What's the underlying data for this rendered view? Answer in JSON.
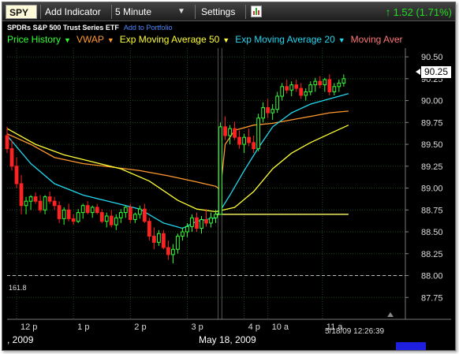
{
  "toolbar": {
    "symbol": "SPY",
    "add_indicator": "Add Indicator",
    "interval": "5 Minute",
    "settings": "Settings",
    "change": "1.52 (1.71%)",
    "change_color": "#22dd22"
  },
  "security": {
    "name": "SPDRs S&P 500 Trust Series ETF",
    "add_to_portfolio": "Add to Portfolio"
  },
  "legend": [
    {
      "label": "Price History",
      "color": "#33ff33"
    },
    {
      "label": "VWAP",
      "color": "#ff9a2e"
    },
    {
      "label": "Exp Moving Average 50",
      "color": "#ffff33"
    },
    {
      "label": "Exp Moving Average 20",
      "color": "#22d8f0"
    },
    {
      "label": "Moving Aver",
      "color": "#ff7777"
    }
  ],
  "price_tag": "90.25",
  "fib_label": "161.8",
  "timestamp": "5/18/09 12:26:39",
  "dates": {
    "left": ", 2009",
    "center": "May 18, 2009"
  },
  "chart_data": {
    "type": "line",
    "title": "",
    "xlabel": "",
    "ylabel": "",
    "grid": true,
    "ylim": [
      87.5,
      90.6
    ],
    "y_ticks": [
      "90.50",
      "90.25",
      "90.00",
      "89.75",
      "89.50",
      "89.25",
      "89.00",
      "88.75",
      "88.50",
      "88.25",
      "88.00",
      "87.75"
    ],
    "x_ticks": [
      "12 p",
      "1 p",
      "2 p",
      "3 p",
      "4 p",
      "10 a",
      "11 a"
    ],
    "x_tick_positions": [
      2.0,
      14.0,
      26.0,
      38.0,
      50.0,
      55.0,
      66.5
    ],
    "x_range": [
      0,
      84
    ],
    "horizontal_line": {
      "label": "161.8",
      "value": 88.0,
      "style": "dashed"
    },
    "candles": [
      [
        89.6,
        89.7,
        89.4,
        89.45
      ],
      [
        89.45,
        89.55,
        89.2,
        89.25
      ],
      [
        89.25,
        89.35,
        89.0,
        89.05
      ],
      [
        89.05,
        89.15,
        88.7,
        88.8
      ],
      [
        88.8,
        88.9,
        88.7,
        88.85
      ],
      [
        88.85,
        88.92,
        88.75,
        88.9
      ],
      [
        88.9,
        88.95,
        88.82,
        88.85
      ],
      [
        88.85,
        88.92,
        88.72,
        88.75
      ],
      [
        88.75,
        88.92,
        88.7,
        88.9
      ],
      [
        88.9,
        88.96,
        88.82,
        88.85
      ],
      [
        88.85,
        88.9,
        88.75,
        88.8
      ],
      [
        88.8,
        88.85,
        88.6,
        88.65
      ],
      [
        88.65,
        88.78,
        88.58,
        88.75
      ],
      [
        88.75,
        88.82,
        88.62,
        88.65
      ],
      [
        88.65,
        88.7,
        88.58,
        88.62
      ],
      [
        88.62,
        88.76,
        88.6,
        88.72
      ],
      [
        88.72,
        88.82,
        88.65,
        88.8
      ],
      [
        88.8,
        88.85,
        88.7,
        88.72
      ],
      [
        88.72,
        88.8,
        88.66,
        88.78
      ],
      [
        88.78,
        88.82,
        88.7,
        88.72
      ],
      [
        88.72,
        88.76,
        88.6,
        88.62
      ],
      [
        88.62,
        88.72,
        88.55,
        88.68
      ],
      [
        88.68,
        88.75,
        88.55,
        88.58
      ],
      [
        88.58,
        88.7,
        88.52,
        88.66
      ],
      [
        88.66,
        88.76,
        88.6,
        88.72
      ],
      [
        88.72,
        88.8,
        88.66,
        88.78
      ],
      [
        88.78,
        88.82,
        88.6,
        88.64
      ],
      [
        88.64,
        88.72,
        88.6,
        88.7
      ],
      [
        88.7,
        88.8,
        88.65,
        88.76
      ],
      [
        88.76,
        88.82,
        88.6,
        88.62
      ],
      [
        88.62,
        88.66,
        88.4,
        88.45
      ],
      [
        88.45,
        88.55,
        88.3,
        88.38
      ],
      [
        88.38,
        88.52,
        88.34,
        88.48
      ],
      [
        88.48,
        88.52,
        88.3,
        88.32
      ],
      [
        88.32,
        88.4,
        88.18,
        88.24
      ],
      [
        88.24,
        88.36,
        88.14,
        88.3
      ],
      [
        88.3,
        88.48,
        88.25,
        88.45
      ],
      [
        88.45,
        88.55,
        88.4,
        88.5
      ],
      [
        88.5,
        88.6,
        88.44,
        88.56
      ],
      [
        88.56,
        88.7,
        88.5,
        88.66
      ],
      [
        88.66,
        88.72,
        88.5,
        88.54
      ],
      [
        88.54,
        88.68,
        88.48,
        88.64
      ],
      [
        88.64,
        88.76,
        88.56,
        88.6
      ],
      [
        88.6,
        88.72,
        88.55,
        88.66
      ],
      [
        88.66,
        88.75,
        88.6,
        88.7
      ],
      [
        88.7,
        89.75,
        89.6,
        89.7
      ],
      [
        89.7,
        89.82,
        89.55,
        89.6
      ],
      [
        89.6,
        89.72,
        89.5,
        89.68
      ],
      [
        89.68,
        89.76,
        89.55,
        89.58
      ],
      [
        89.58,
        89.66,
        89.45,
        89.5
      ],
      [
        89.5,
        89.62,
        89.4,
        89.58
      ],
      [
        89.58,
        89.68,
        89.48,
        89.52
      ],
      [
        89.52,
        89.6,
        89.4,
        89.45
      ],
      [
        89.45,
        89.85,
        89.42,
        89.8
      ],
      [
        89.8,
        89.98,
        89.75,
        89.92
      ],
      [
        89.92,
        90.02,
        89.8,
        89.86
      ],
      [
        89.86,
        89.96,
        89.78,
        89.9
      ],
      [
        89.9,
        90.1,
        89.86,
        90.05
      ],
      [
        90.05,
        90.2,
        90.0,
        90.16
      ],
      [
        90.16,
        90.24,
        90.08,
        90.12
      ],
      [
        90.12,
        90.22,
        90.05,
        90.18
      ],
      [
        90.18,
        90.24,
        90.1,
        90.14
      ],
      [
        90.14,
        90.2,
        90.02,
        90.06
      ],
      [
        90.06,
        90.14,
        90.0,
        90.1
      ],
      [
        90.1,
        90.22,
        90.06,
        90.18
      ],
      [
        90.18,
        90.26,
        90.1,
        90.22
      ],
      [
        90.22,
        90.28,
        90.14,
        90.18
      ],
      [
        90.18,
        90.26,
        90.1,
        90.24
      ],
      [
        90.24,
        90.3,
        90.06,
        90.1
      ],
      [
        90.1,
        90.2,
        90.06,
        90.16
      ],
      [
        90.16,
        90.24,
        90.1,
        90.2
      ],
      [
        90.2,
        90.3,
        90.16,
        90.25
      ]
    ],
    "series": [
      {
        "name": "VWAP",
        "color": "#ff9a2e",
        "points": [
          [
            0,
            89.62
          ],
          [
            5,
            89.5
          ],
          [
            10,
            89.35
          ],
          [
            16,
            89.28
          ],
          [
            22,
            89.24
          ],
          [
            28,
            89.2
          ],
          [
            34,
            89.14
          ],
          [
            40,
            89.07
          ],
          [
            44,
            89.02
          ],
          [
            45,
            88.98
          ],
          [
            46,
            89.5
          ],
          [
            48,
            89.66
          ],
          [
            52,
            89.72
          ],
          [
            56,
            89.74
          ],
          [
            60,
            89.78
          ],
          [
            64,
            89.82
          ],
          [
            68,
            89.86
          ],
          [
            72,
            89.88
          ]
        ]
      },
      {
        "name": "Exp Moving Average 50",
        "color": "#ffff33",
        "points": [
          [
            0,
            89.68
          ],
          [
            6,
            89.5
          ],
          [
            12,
            89.38
          ],
          [
            18,
            89.3
          ],
          [
            24,
            89.22
          ],
          [
            30,
            89.08
          ],
          [
            36,
            88.86
          ],
          [
            40,
            88.76
          ],
          [
            44,
            88.73
          ],
          [
            48,
            88.78
          ],
          [
            52,
            88.96
          ],
          [
            56,
            89.22
          ],
          [
            60,
            89.4
          ],
          [
            64,
            89.52
          ],
          [
            68,
            89.62
          ],
          [
            72,
            89.72
          ]
        ]
      },
      {
        "name": "Exp Moving Average 20",
        "color": "#22d8f0",
        "points": [
          [
            0,
            89.6
          ],
          [
            5,
            89.28
          ],
          [
            10,
            89.05
          ],
          [
            16,
            88.92
          ],
          [
            22,
            88.84
          ],
          [
            28,
            88.76
          ],
          [
            33,
            88.6
          ],
          [
            37,
            88.54
          ],
          [
            40,
            88.62
          ],
          [
            44,
            88.66
          ],
          [
            47,
            88.92
          ],
          [
            50,
            89.2
          ],
          [
            53,
            89.46
          ],
          [
            56,
            89.7
          ],
          [
            60,
            89.86
          ],
          [
            64,
            89.96
          ],
          [
            68,
            90.02
          ],
          [
            72,
            90.08
          ]
        ]
      },
      {
        "name": "Moving Aver",
        "color": "#ffff66",
        "points": [
          [
            44,
            88.7
          ],
          [
            72,
            88.7
          ]
        ]
      }
    ]
  }
}
